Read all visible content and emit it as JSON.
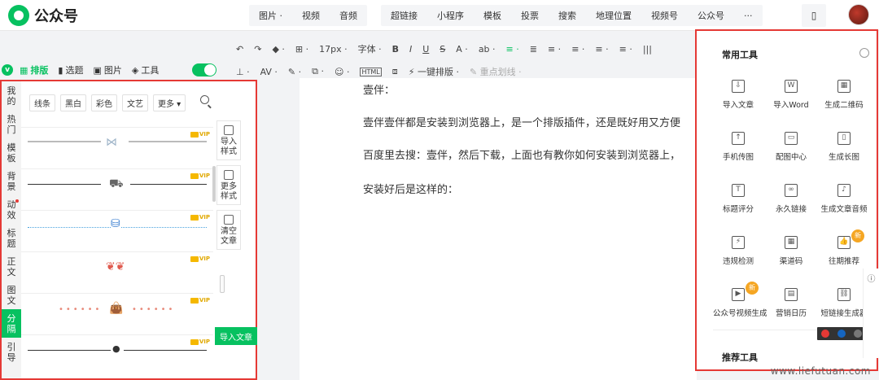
{
  "app": {
    "logo_text": "公众号"
  },
  "top_menu": {
    "group1": [
      "图片 ·",
      "视频",
      "音频"
    ],
    "group2": [
      "超链接",
      "小程序",
      "模板",
      "投票",
      "搜索",
      "地理位置",
      "视频号",
      "公众号",
      "···"
    ]
  },
  "toolbar": {
    "row1": [
      "↶",
      "↷",
      "◆ ·",
      "⊞ ·",
      "17px ·",
      "字体 ·",
      "B",
      "I",
      "U",
      "S",
      "A ·",
      "ab ·",
      "≡ ·",
      "≣",
      "≡ ·",
      "≡ ·",
      "≡ ·",
      "≡ ·",
      "|||"
    ],
    "row2": [
      "⊥ ·",
      "AV ·",
      "✎ ·",
      "⧉ ·",
      "☺ ·",
      "HTML",
      "⧈",
      "⚡ 一键排版 ·",
      "✎ 重点划线 ·"
    ]
  },
  "left_tabs": [
    {
      "icon": "layout-icon",
      "label": "排版",
      "active": true
    },
    {
      "icon": "topic-icon",
      "label": "选题",
      "active": false
    },
    {
      "icon": "image-icon",
      "label": "图片",
      "active": false
    },
    {
      "icon": "tool-icon",
      "label": "工具",
      "active": false
    }
  ],
  "categories": [
    "我的",
    "热门",
    "模板",
    "背景",
    "动效",
    "标题",
    "正文",
    "图文",
    "分隔",
    "引导"
  ],
  "active_category": "分隔",
  "filters": [
    "线条",
    "黑白",
    "彩色",
    "文艺",
    "更多 ▾"
  ],
  "vip_label": "VIP",
  "side_actions": [
    "导入样式",
    "更多样式",
    "清空文章"
  ],
  "import_button": "导入文章",
  "editor": {
    "paragraphs": [
      "壹伴：",
      "壹伴壹伴都是安装到浏览器上，是一个排版插件，还是既好用又方便",
      "百度里去搜：壹伴，然后下载，上面也有教你如何安装到浏览器上，",
      "安装好后是这样的："
    ]
  },
  "right_panel": {
    "title": "常用工具",
    "tools": [
      {
        "label": "导入文章",
        "icon": "import-icon",
        "glyph": "⇩"
      },
      {
        "label": "导入Word",
        "icon": "word-icon",
        "glyph": "W"
      },
      {
        "label": "生成二维码",
        "icon": "qrcode-icon",
        "glyph": "▦"
      },
      {
        "label": "手机传图",
        "icon": "phone-icon",
        "glyph": "↑"
      },
      {
        "label": "配图中心",
        "icon": "picture-icon",
        "glyph": "▭"
      },
      {
        "label": "生成长图",
        "icon": "long-image-icon",
        "glyph": "▯"
      },
      {
        "label": "标题评分",
        "icon": "title-score-icon",
        "glyph": "T"
      },
      {
        "label": "永久链接",
        "icon": "link-icon",
        "glyph": "∞"
      },
      {
        "label": "生成文章音频",
        "icon": "audio-icon",
        "glyph": "♪"
      },
      {
        "label": "违规检测",
        "icon": "shield-icon",
        "glyph": "⚡"
      },
      {
        "label": "渠道码",
        "icon": "channel-qrcode-icon",
        "glyph": "▦"
      },
      {
        "label": "往期推荐",
        "icon": "thumb-icon",
        "glyph": "👍",
        "badge": "新"
      },
      {
        "label": "公众号视频生成",
        "icon": "video-icon",
        "glyph": "▶",
        "badge": "新"
      },
      {
        "label": "营销日历",
        "icon": "calendar-icon",
        "glyph": "▤"
      },
      {
        "label": "短链接生成器",
        "icon": "short-link-icon",
        "glyph": "⛓"
      }
    ],
    "subtitle": "推荐工具"
  },
  "watermark": "www.liefutuan.com"
}
